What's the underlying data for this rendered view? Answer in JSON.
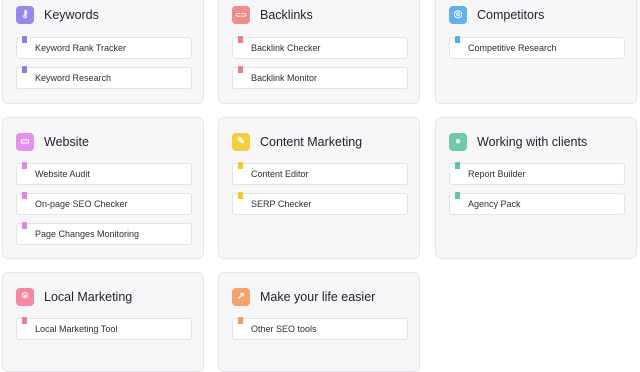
{
  "cards": [
    {
      "title": "Keywords",
      "icon": "key-icon",
      "glyph": "⚷",
      "color": "#9b86f0",
      "flag": "#8c7de8",
      "items": [
        "Keyword Rank Tracker",
        "Keyword Research"
      ]
    },
    {
      "title": "Backlinks",
      "icon": "link-icon",
      "glyph": "⊂⊃",
      "color": "#f28a8a",
      "flag": "#ef7d7d",
      "items": [
        "Backlink Checker",
        "Backlink Monitor"
      ]
    },
    {
      "title": "Competitors",
      "icon": "target-icon",
      "glyph": "◎",
      "color": "#5fb1f0",
      "flag": "#5aa9ec",
      "items": [
        "Competitive Research"
      ]
    },
    {
      "title": "Website",
      "icon": "browser-icon",
      "glyph": "▭",
      "color": "#e590ec",
      "flag": "#dd86e8",
      "items": [
        "Website Audit",
        "On-page SEO Checker",
        "Page Changes Monitoring"
      ]
    },
    {
      "title": "Content Marketing",
      "icon": "edit-icon",
      "glyph": "✎",
      "color": "#f6cd3d",
      "flag": "#f4c72e",
      "items": [
        "Content Editor",
        "SERP Checker"
      ]
    },
    {
      "title": "Working with clients",
      "icon": "user-icon",
      "glyph": "●",
      "color": "#6fcaa9",
      "flag": "#63c29f",
      "items": [
        "Report Builder",
        "Agency Pack"
      ]
    },
    {
      "title": "Local Marketing",
      "icon": "location-pin-icon",
      "glyph": "⌾",
      "color": "#f38aa2",
      "flag": "#ef7f98",
      "items": [
        "Local Marketing Tool"
      ]
    },
    {
      "title": "Make your life easier",
      "icon": "trend-up-icon",
      "glyph": "↗",
      "color": "#f5a36b",
      "flag": "#f39a5e",
      "items": [
        "Other SEO tools"
      ]
    }
  ]
}
